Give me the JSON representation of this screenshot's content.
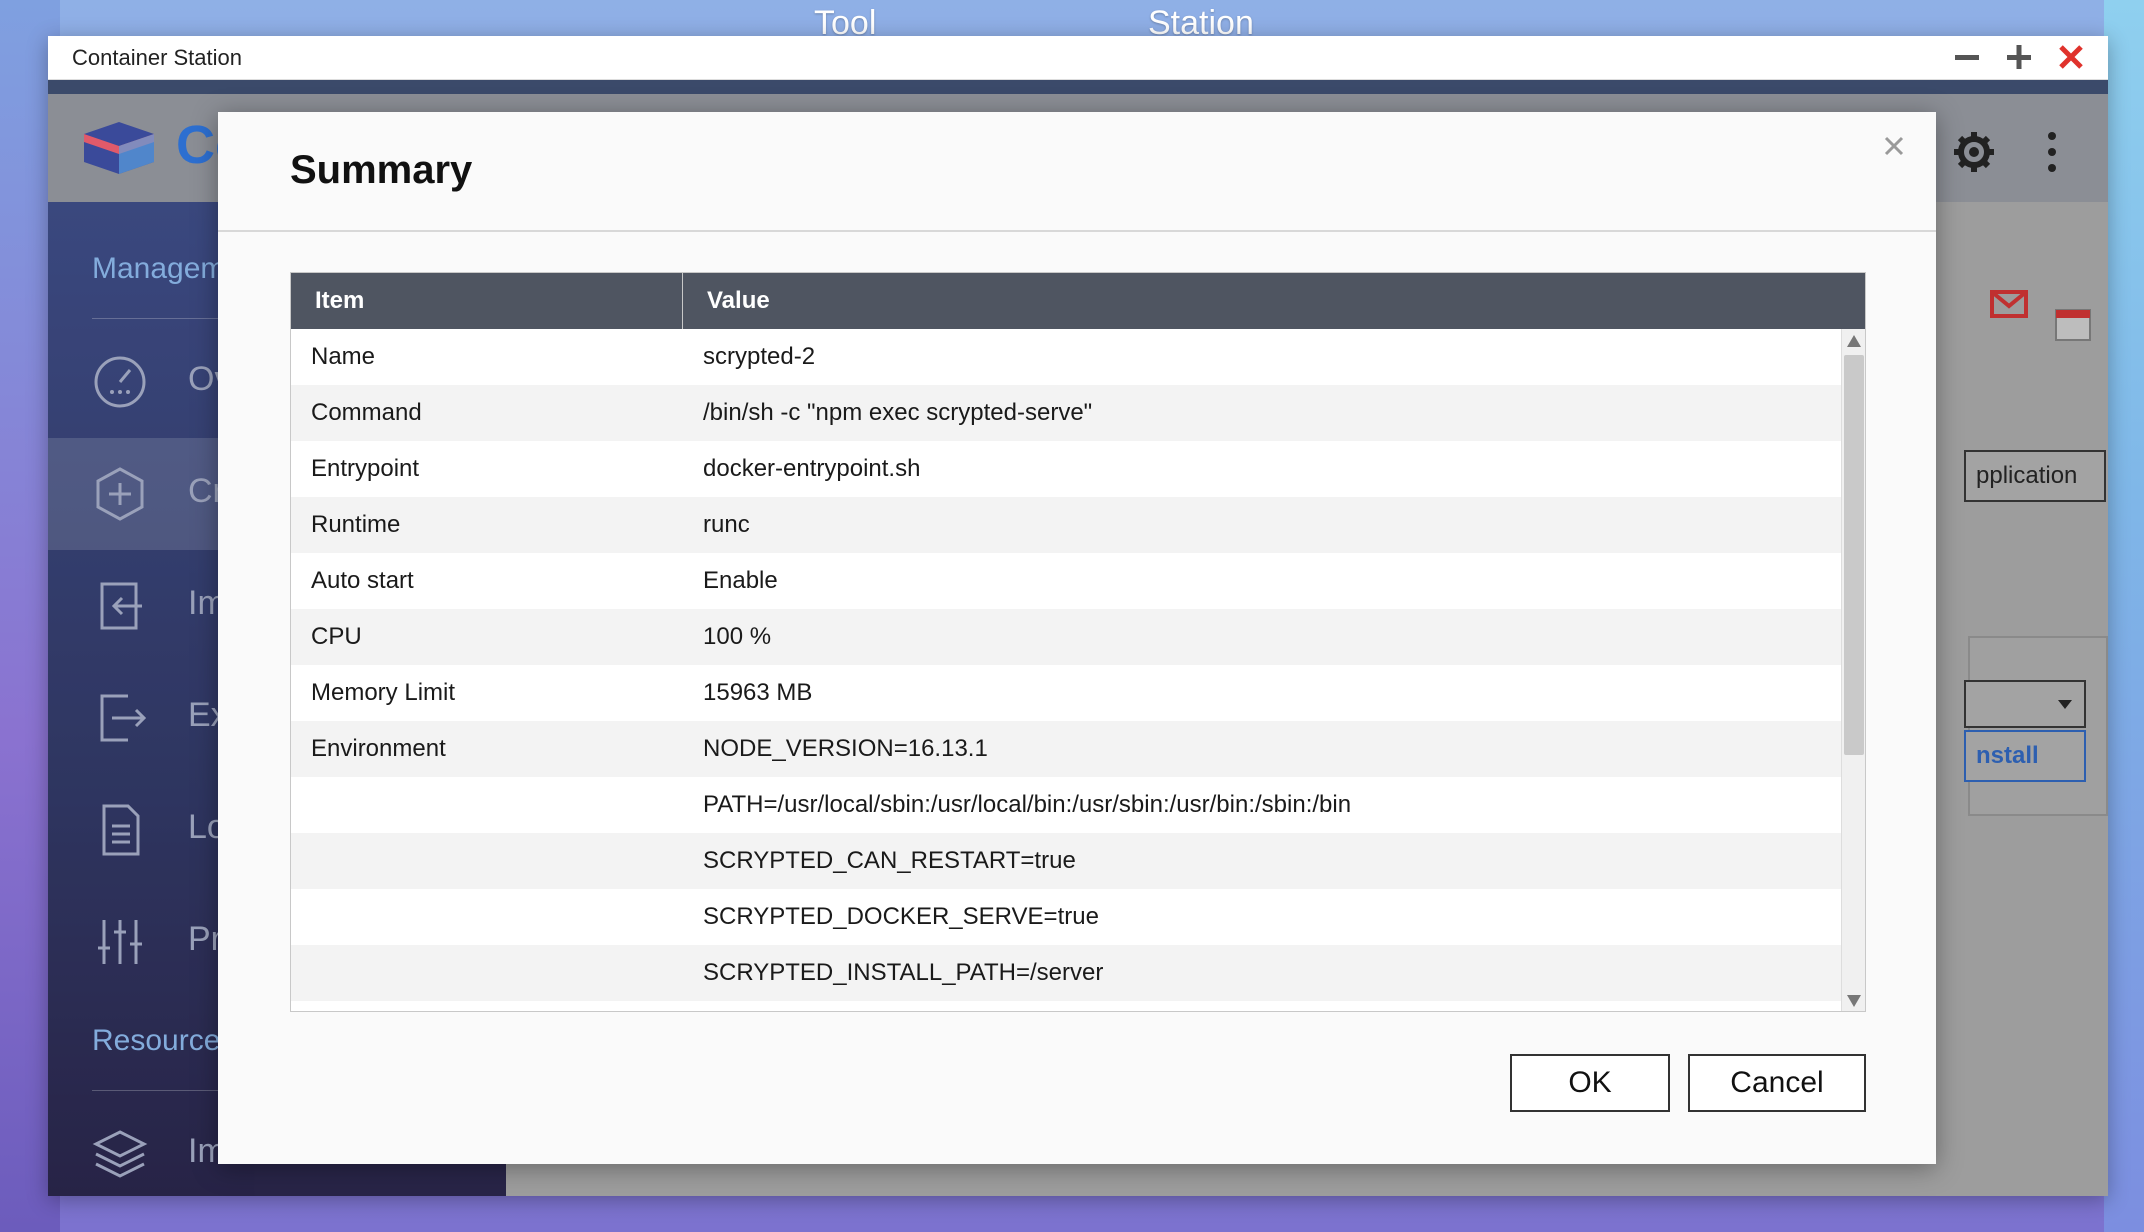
{
  "desktop": {
    "label_left": "Tool",
    "label_right": "Station"
  },
  "window": {
    "title": "Container Station"
  },
  "app": {
    "title": "Co"
  },
  "sidebar": {
    "section_management": "Managem",
    "items": [
      {
        "label": "Ov",
        "icon": "dashboard-icon"
      },
      {
        "label": "Cr",
        "icon": "plus-hexagon-icon"
      },
      {
        "label": "Im",
        "icon": "import-icon"
      },
      {
        "label": "Ex",
        "icon": "export-icon"
      },
      {
        "label": "Lo",
        "icon": "document-icon"
      },
      {
        "label": "Pr",
        "icon": "sliders-icon"
      }
    ],
    "section_resource": "Resource",
    "resource_items": [
      {
        "label": "Im",
        "icon": "layers-icon"
      }
    ]
  },
  "background": {
    "application_button": "pplication",
    "install_button": "nstall"
  },
  "modal": {
    "title": "Summary",
    "columns": {
      "item": "Item",
      "value": "Value"
    },
    "rows": [
      {
        "item": "Name",
        "value": "scrypted-2"
      },
      {
        "item": "Command",
        "value": "/bin/sh -c \"npm exec scrypted-serve\""
      },
      {
        "item": "Entrypoint",
        "value": "docker-entrypoint.sh"
      },
      {
        "item": "Runtime",
        "value": "runc"
      },
      {
        "item": "Auto start",
        "value": "Enable"
      },
      {
        "item": "CPU",
        "value": "100 %"
      },
      {
        "item": "Memory Limit",
        "value": "15963 MB"
      },
      {
        "item": "Environment",
        "value": "NODE_VERSION=16.13.1"
      },
      {
        "item": "",
        "value": "PATH=/usr/local/sbin:/usr/local/bin:/usr/sbin:/usr/bin:/sbin:/bin"
      },
      {
        "item": "",
        "value": "SCRYPTED_CAN_RESTART=true"
      },
      {
        "item": "",
        "value": "SCRYPTED_DOCKER_SERVE=true"
      },
      {
        "item": "",
        "value": "SCRYPTED_INSTALL_PATH=/server"
      }
    ],
    "ok_label": "OK",
    "cancel_label": "Cancel"
  }
}
